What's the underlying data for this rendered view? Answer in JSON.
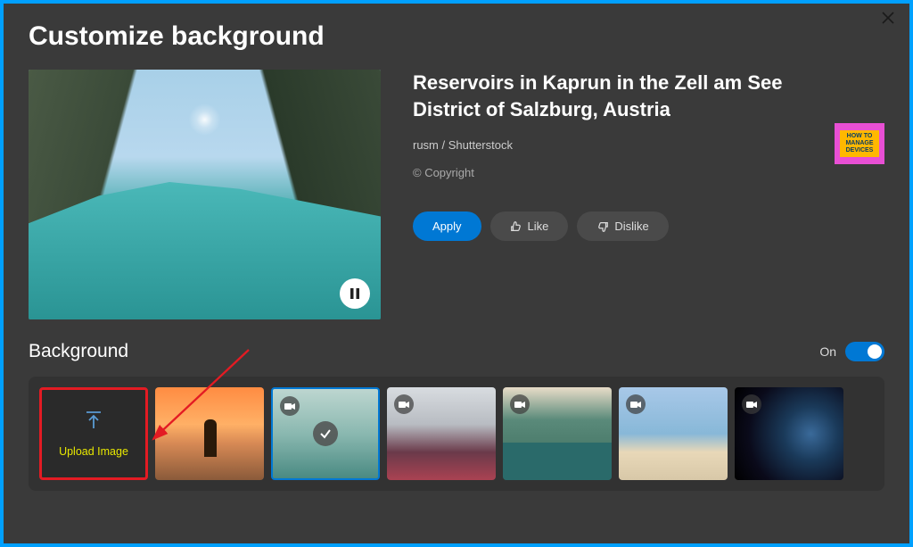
{
  "dialog": {
    "title": "Customize background"
  },
  "preview": {
    "title": "Reservoirs in Kaprun in the Zell am See District of Salzburg, Austria",
    "credit": "rusm / Shutterstock",
    "copyright": "© Copyright"
  },
  "actions": {
    "apply": "Apply",
    "like": "Like",
    "dislike": "Dislike"
  },
  "section": {
    "title": "Background",
    "toggle_label": "On",
    "toggle_state": true
  },
  "thumbnails": {
    "upload_label": "Upload Image",
    "selected_index": 2
  },
  "badge": {
    "line1": "HOW TO",
    "line2": "MANAGE",
    "line3": "DEVICES"
  }
}
